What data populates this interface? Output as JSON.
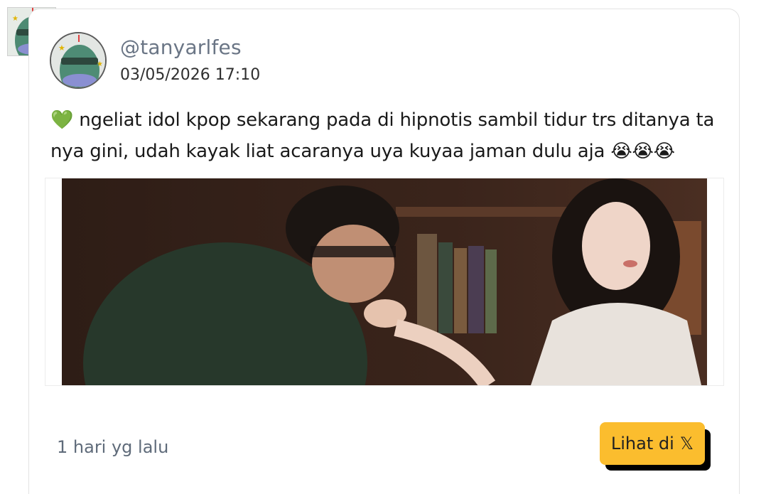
{
  "post": {
    "handle": "@tanyarlfes",
    "timestamp": "03/05/2026 17:10",
    "text": "💚 ngeliat idol kpop sekarang pada di hipnotis sambil tidur trs ditanya ta nya gini, udah kayak liat acaranya uya kuyaa jaman dulu aja 😭😭😭",
    "relative_time": "1 hari yg lalu"
  },
  "actions": {
    "view_label": "Lihat di",
    "view_icon": "𝕏"
  },
  "icons": {
    "avatar": "cartoon-fish-avatar-icon",
    "platform": "x-logo-icon"
  },
  "colors": {
    "button_bg": "#fbbd2e",
    "handle": "#6a7585",
    "muted": "#5f6b7a"
  }
}
